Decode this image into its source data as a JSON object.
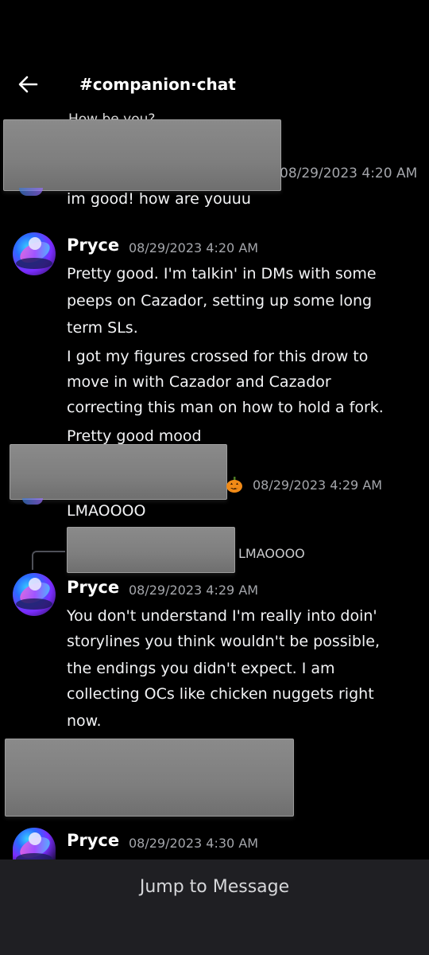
{
  "header": {
    "back_icon": "arrow-left-icon",
    "channel": "#companion·chat"
  },
  "messages": {
    "m1": {
      "peek_text": "How be you?",
      "timestamp": "08/29/2023 4:20 AM",
      "text": "im good! how are youuu"
    },
    "m2": {
      "author": "Pryce",
      "timestamp": "08/29/2023 4:20 AM",
      "lines": [
        "Pretty good. I'm talkin' in DMs with some",
        "peeps on Cazador, setting up some long",
        "term SLs.",
        "I got my figures crossed for this drow to",
        "move in with Cazador and Cazador",
        "correcting this man on how to hold a fork.",
        "Pretty good mood"
      ]
    },
    "m3": {
      "badge_icon": "pumpkin-icon",
      "timestamp": "08/29/2023 4:29 AM",
      "text": "LMAOOOO"
    },
    "m4": {
      "reply_preview": "LMAOOOO",
      "author": "Pryce",
      "timestamp": "08/29/2023 4:29 AM",
      "lines": [
        "You don't understand I'm really into doin'",
        "storylines you think wouldn't be possible,",
        "the endings you didn't expect. I am",
        "collecting OCs like chicken nuggets right",
        "now."
      ]
    },
    "m5": {
      "author": "Pryce",
      "timestamp": "08/29/2023 4:30 AM"
    }
  },
  "footer": {
    "jump_label": "Jump to Message"
  },
  "colors": {
    "background": "#000000",
    "footer_bg": "#1f1f23",
    "timestamp": "#a4a6ab",
    "redaction": "#808080"
  }
}
